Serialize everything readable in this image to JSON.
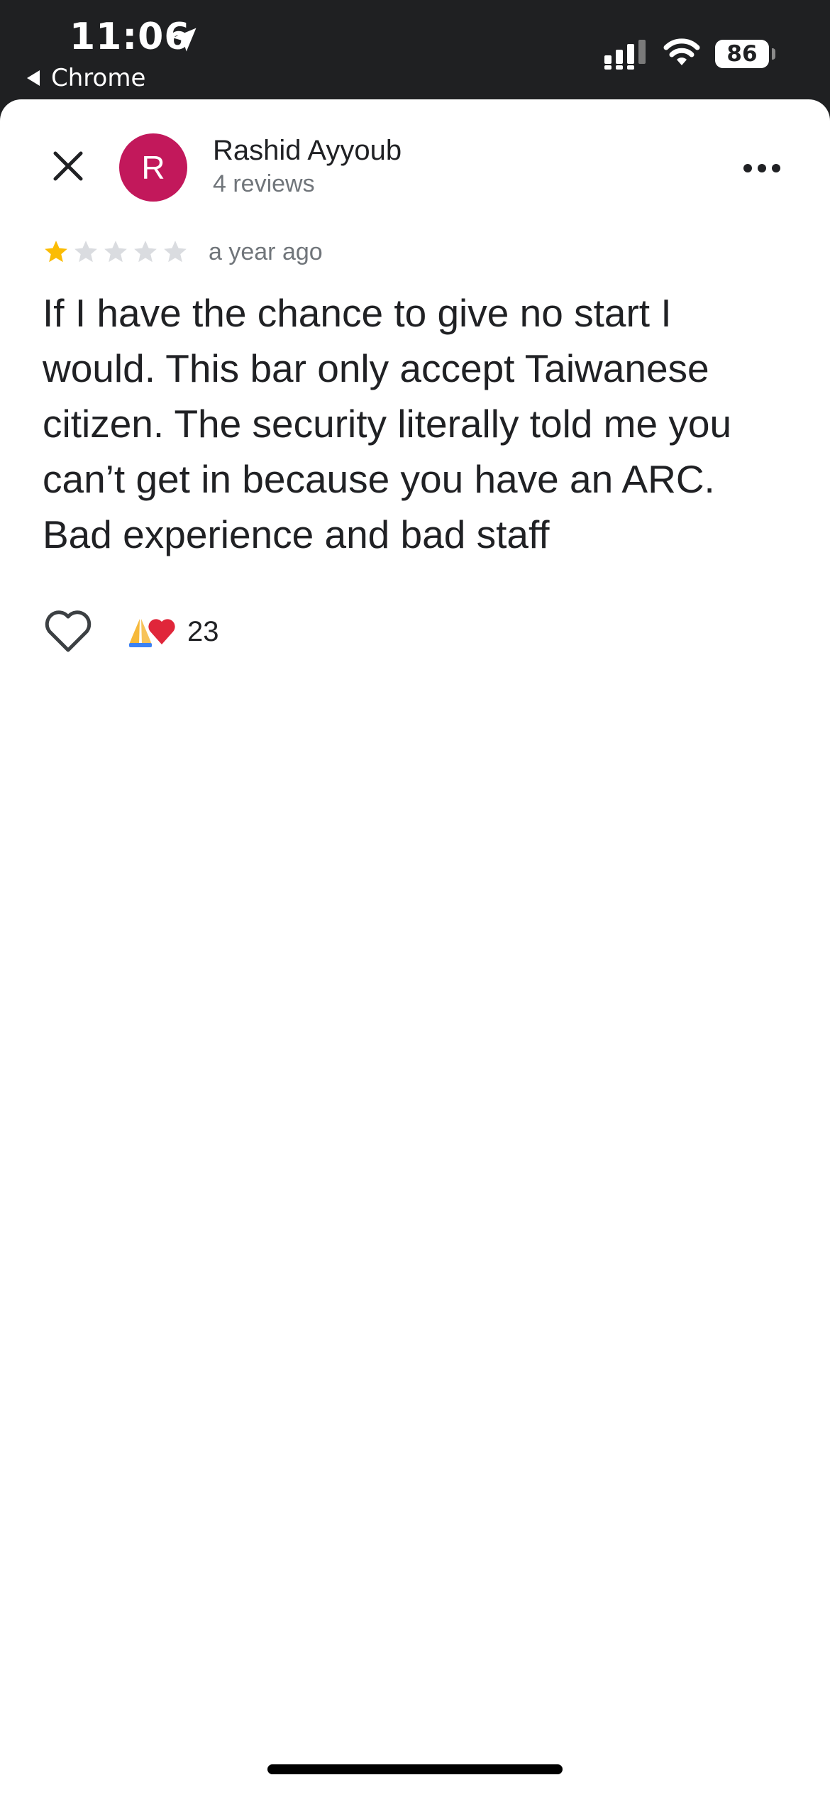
{
  "status_bar": {
    "time": "11:06",
    "back_app": "Chrome",
    "battery": "86",
    "icons": [
      "location-arrow-icon",
      "cellular-signal-icon",
      "wifi-icon",
      "battery-icon"
    ]
  },
  "review": {
    "author_initial": "R",
    "author_name": "Rashid Ayyoub",
    "author_review_count": "4 reviews",
    "avatar_color": "#c2185b",
    "rating": 1,
    "rating_max": 5,
    "date": "a year ago",
    "text": "If I have the chance to give no start I would. This bar only accept Taiwanese citizen. The security literally told me you can’t get in because you have an ARC. Bad experience and bad staff",
    "reaction_count": "23",
    "reaction_emojis": [
      "folded-hands",
      "red-heart"
    ]
  },
  "colors": {
    "star_filled": "#fbbc04",
    "star_empty": "#dadce0",
    "status_bar_bg": "#1f2022"
  }
}
